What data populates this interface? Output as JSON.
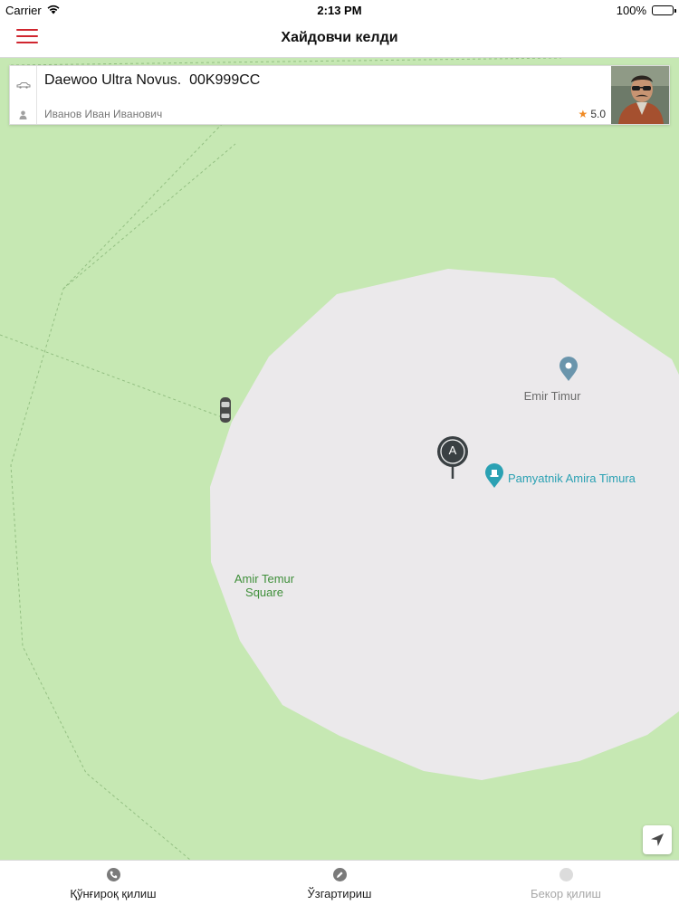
{
  "status_bar": {
    "carrier": "Carrier",
    "time": "2:13 PM",
    "battery": "100%",
    "battery_level": 1.0
  },
  "nav": {
    "title": "Хайдовчи келди",
    "menu_icon": "hamburger-menu-icon",
    "accent_color": "#d0262f"
  },
  "driver_card": {
    "car_model": "Daewoo Ultra Novus.",
    "plate": "00K999CC",
    "driver_name": "Иванов Иван Иванович",
    "rating": "5.0",
    "car_icon": "car-icon",
    "person_icon": "person-icon",
    "star_icon": "star-icon",
    "photo": "driver-photo"
  },
  "map": {
    "labels": {
      "emir_timur": "Emir Timur",
      "pamyatnik": "Pamyatnik Amira Timura",
      "square_line1": "Amir Temur",
      "square_line2": "Square"
    },
    "marker_a": "A",
    "colors": {
      "park": "#c6e8b3",
      "plaza": "#ebe9eb",
      "marker": "#3a4043",
      "poi_teal": "#2ba1b3",
      "poi_grey": "#6a95ac"
    }
  },
  "bottom_bar": {
    "actions": [
      {
        "label": "Қўнғироқ қилиш",
        "icon": "phone-icon",
        "enabled": true
      },
      {
        "label": "Ўзгартириш",
        "icon": "edit-icon",
        "enabled": true
      },
      {
        "label": "Бекор қилиш",
        "icon": "cancel-icon",
        "enabled": false
      }
    ]
  }
}
